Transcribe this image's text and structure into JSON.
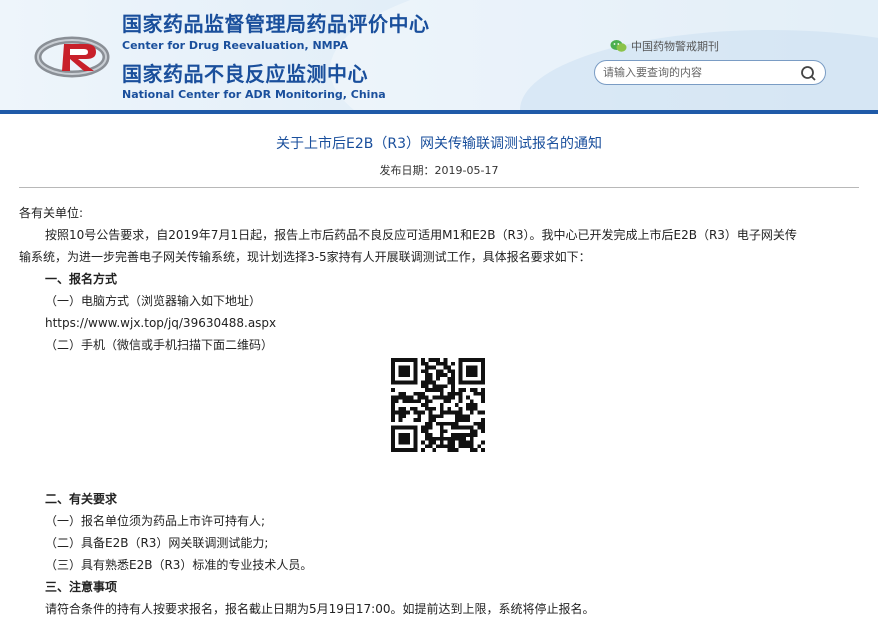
{
  "header": {
    "cn_title_1": "国家药品监督管理局药品评价中心",
    "en_title_1": "Center for Drug Reevaluation, NMPA",
    "cn_title_2": "国家药品不良反应监测中心",
    "en_title_2": "National Center for ADR Monitoring, China",
    "wechat_label": "中国药物警戒期刊",
    "search_placeholder": "请输入要查询的内容",
    "logo_icon": "cdr-logo-icon",
    "wechat_icon": "wechat-icon",
    "search_icon": "search-icon"
  },
  "article": {
    "title": "关于上市后E2B（R3）网关传输联调测试报名的通知",
    "pubdate_label": "发布日期：",
    "pubdate": "2019-05-17",
    "salutation": "各有关单位:",
    "intro_1": "按照10号公告要求，自2019年7月1日起，报告上市后药品不良反应可适用M1和E2B（R3）。我中心已开发完成上市后E2B（R3）电子网关传",
    "intro_2": "输系统，为进一步完善电子网关传输系统，现计划选择3-5家持有人开展联调测试工作，具体报名要求如下：",
    "s1_heading": "一、报名方式",
    "s1_item1": "（一）电脑方式（浏览器输入如下地址）",
    "s1_url": "https://www.wjx.top/jq/39630488.aspx",
    "s1_item2": "（二）手机（微信或手机扫描下面二维码）",
    "qr_icon": "qr-code-icon",
    "s2_heading": "二、有关要求",
    "s2_item1": "（一）报名单位须为药品上市许可持有人;",
    "s2_item2": "（二）具备E2B（R3）网关联调测试能力;",
    "s2_item3": "（三）具有熟悉E2B（R3）标准的专业技术人员。",
    "s3_heading": "三、注意事项",
    "s3_text": "请符合条件的持有人按要求报名，报名截止日期为5月19日17:00。如提前达到上限，系统将停止报名。"
  },
  "colors": {
    "brand_blue": "#1a4f9c",
    "bar_blue": "#1f5aa8"
  }
}
